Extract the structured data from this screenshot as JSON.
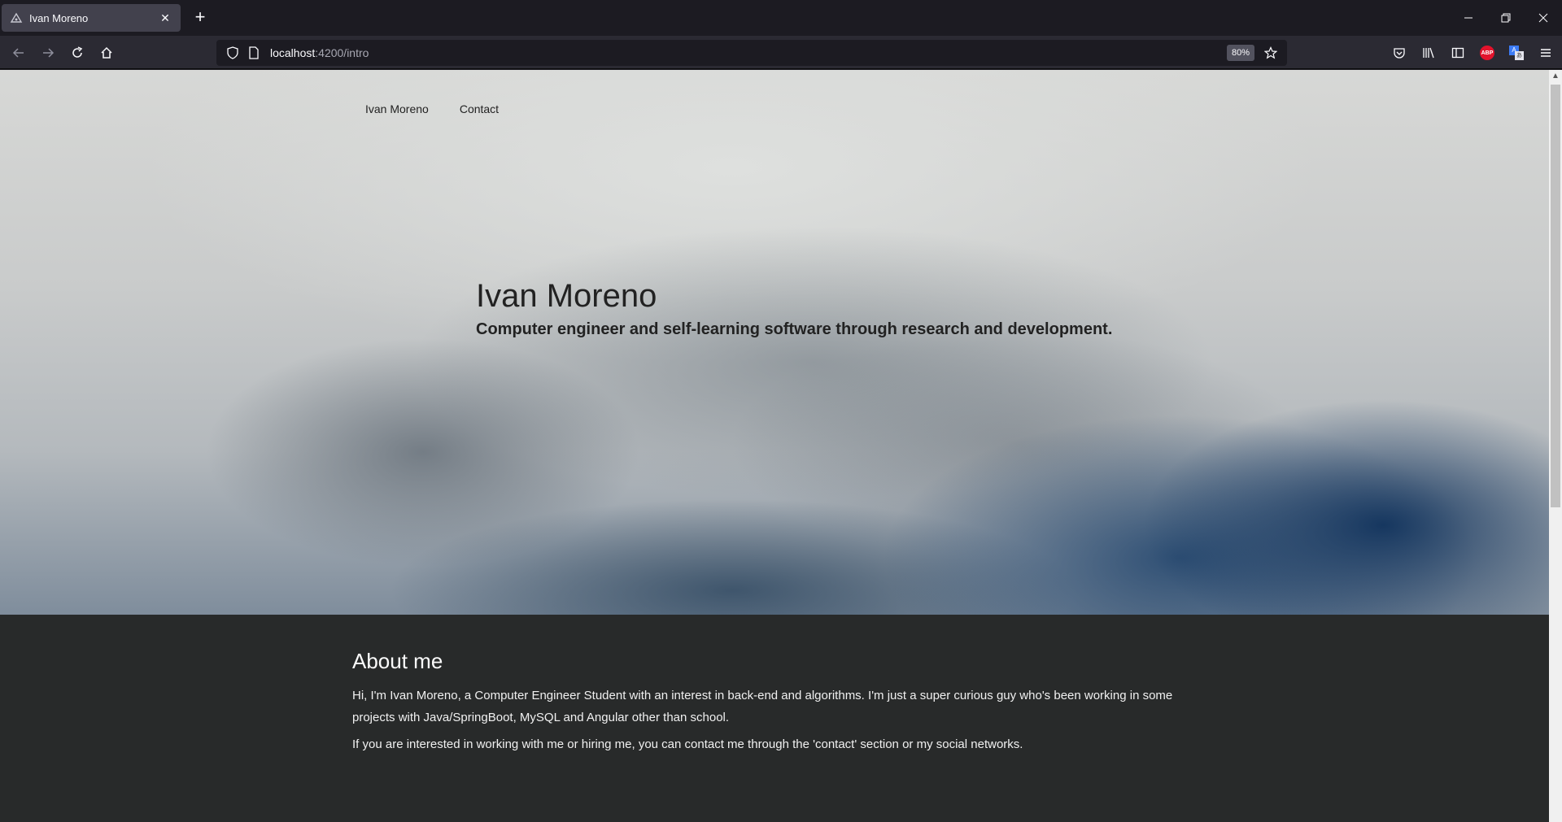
{
  "browser": {
    "tab_title": "Ivan Moreno",
    "url_host": "localhost",
    "url_path": ":4200/intro",
    "zoom": "80%"
  },
  "site": {
    "nav": [
      "Ivan Moreno",
      "Contact"
    ],
    "hero_title": "Ivan Moreno",
    "hero_subtitle": "Computer engineer and self-learning software through research and development.",
    "about_title": "About me",
    "about_p1": "Hi, I'm Ivan Moreno, a Computer Engineer Student with an interest in back-end and algorithms. I'm just a super curious guy who's been working in some projects with Java/SpringBoot, MySQL and Angular other than school.",
    "about_p2": "If you are interested in working with me or hiring me, you can contact me through the 'contact' section or my social networks."
  },
  "icons": {
    "tab": "firefox-tab-icon",
    "abp": "adblock-plus-icon",
    "translate": "translate-icon"
  }
}
